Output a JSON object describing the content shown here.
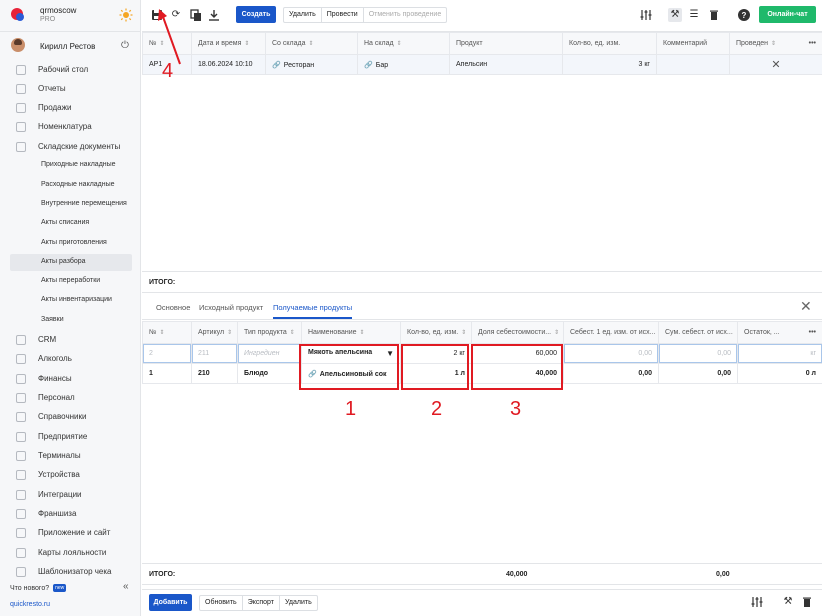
{
  "brand": {
    "name": "qrmoscow",
    "plan": "PRO"
  },
  "user": {
    "name": "Кирилл Рестов"
  },
  "nav": [
    {
      "label": "Рабочий стол",
      "icon": "dashboard-icon"
    },
    {
      "label": "Отчеты",
      "icon": "reports-icon"
    },
    {
      "label": "Продажи",
      "icon": "sales-icon"
    },
    {
      "label": "Номенклатура",
      "icon": "nomenclature-icon"
    },
    {
      "label": "Складские документы",
      "icon": "warehouse-icon"
    }
  ],
  "subnav": [
    "Приходные накладные",
    "Расходные накладные",
    "Внутренние перемещения",
    "Акты списания",
    "Акты приготовления",
    "Акты разбора",
    "Акты переработки",
    "Акты инвентаризации",
    "Заявки"
  ],
  "nav2": [
    {
      "label": "CRM",
      "icon": "crm-icon"
    },
    {
      "label": "Алкоголь",
      "icon": "alcohol-icon"
    },
    {
      "label": "Финансы",
      "icon": "finance-icon"
    },
    {
      "label": "Персонал",
      "icon": "staff-icon"
    },
    {
      "label": "Справочники",
      "icon": "reference-icon"
    },
    {
      "label": "Предприятие",
      "icon": "enterprise-icon"
    },
    {
      "label": "Терминалы",
      "icon": "terminal-icon"
    },
    {
      "label": "Устройства",
      "icon": "devices-icon"
    },
    {
      "label": "Интеграции",
      "icon": "integrations-icon"
    },
    {
      "label": "Франшиза",
      "icon": "franchise-icon"
    },
    {
      "label": "Приложение и сайт",
      "icon": "app-icon"
    },
    {
      "label": "Карты лояльности",
      "icon": "loyalty-icon"
    },
    {
      "label": "Шаблонизатор чека",
      "icon": "receipt-icon"
    }
  ],
  "footer": {
    "whatsnew": "Что нового?",
    "badge": "new",
    "site": "quickresto.ru"
  },
  "toolbar": {
    "create": "Создать",
    "delete": "Удалить",
    "post": "Провести",
    "unpost": "Отменить проведение",
    "chat": "Онлайн-чат"
  },
  "top_table": {
    "headers": [
      "№",
      "Дата и время",
      "Со склада",
      "На склад",
      "Продукт",
      "Кол-во, ед. изм.",
      "Комментарий",
      "Проведен"
    ],
    "row": {
      "num": "АР1",
      "date": "18.06.2024 10:10",
      "from": "Ресторан",
      "to": "Бар",
      "product": "Апельсин",
      "qty": "3 кг",
      "comment": "",
      "posted": "✕"
    },
    "total_label": "ИТОГО:"
  },
  "tabs": [
    "Основное",
    "Исходный продукт",
    "Получаемые продукты"
  ],
  "bottom_table": {
    "headers": [
      "№",
      "Артикул",
      "Тип продукта",
      "Наименование",
      "Кол-во, ед. изм.",
      "Доля себестоимости...",
      "Себест. 1 ед. изм. от исх...",
      "Сум. себест. от исх...",
      "Остаток, ..."
    ],
    "rows": [
      {
        "num": "2",
        "article": "211",
        "type": "Ингредиен",
        "name": "Мякоть апельсина",
        "qty": "2 кг",
        "share": "60,000",
        "cost1": "0,00",
        "sumcost": "0,00",
        "rest": "кг"
      },
      {
        "num": "1",
        "article": "210",
        "type": "Блюдо",
        "name": "Апельсиновый сок",
        "qty": "1 л",
        "share": "40,000",
        "cost1": "0,00",
        "sumcost": "0,00",
        "rest": "0 л"
      }
    ],
    "total_label": "ИТОГО:",
    "total_share": "40,000",
    "total_sumcost": "0,00"
  },
  "annotations": [
    "1",
    "2",
    "3",
    "4"
  ],
  "bottom_bar": {
    "add": "Добавить",
    "refresh": "Обновить",
    "export": "Экспорт",
    "delete": "Удалить"
  }
}
